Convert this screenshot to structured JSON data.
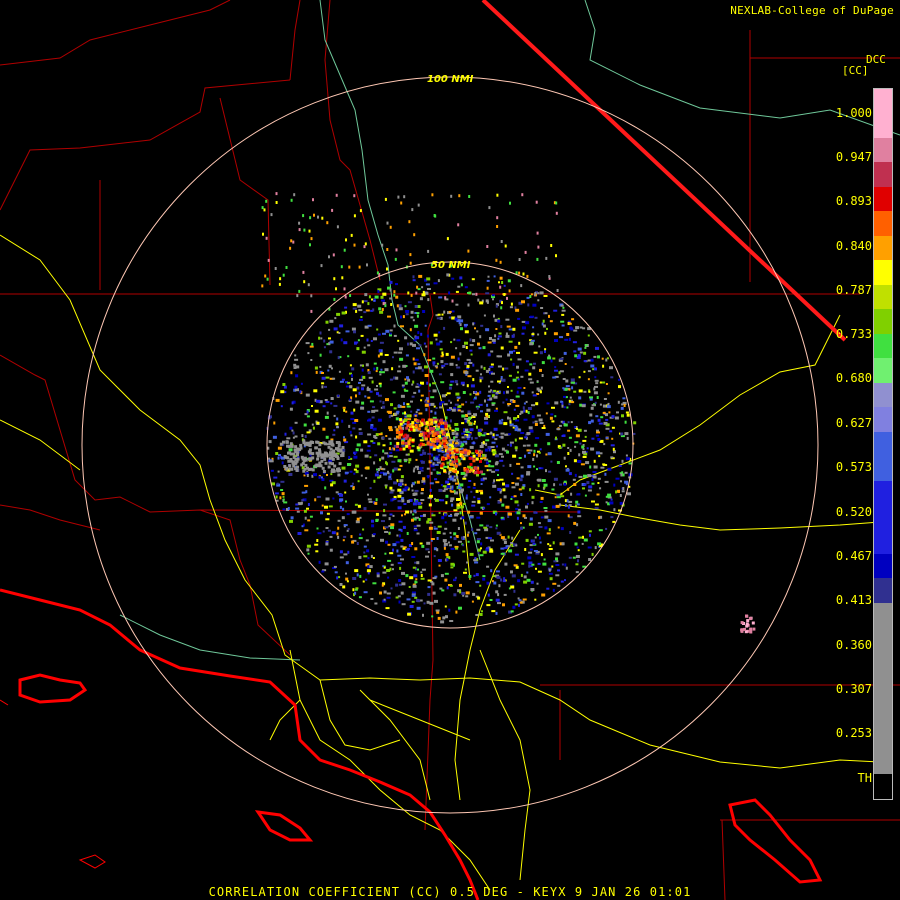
{
  "credit": "NEXLAB-College of DuPage",
  "station_code": "DCC",
  "unit_label": "[CC]",
  "legend_labels": [
    "1.000",
    "0.947",
    "0.893",
    "0.840",
    "0.787",
    "0.733",
    "0.680",
    "0.627",
    "0.573",
    "0.520",
    "0.467",
    "0.413",
    "0.360",
    "0.307",
    "0.253",
    "TH"
  ],
  "legend_colors": [
    "#ffb0d0",
    "#e080a0",
    "#c03050",
    "#e00000",
    "#ff6000",
    "#ffa000",
    "#ffff00",
    "#c0e000",
    "#80d000",
    "#40e040",
    "#70f070",
    "#9090d0",
    "#8080e0",
    "#4060e0",
    "#2020e0",
    "#0000c0",
    "#303090",
    "#909090",
    "#000000"
  ],
  "range_rings": [
    "50 NMI",
    "100 NMI"
  ],
  "footer": "CORRELATION COEFFICIENT (CC) 0.5 DEG - KEYX 9 JAN 26 01:01",
  "colors": {
    "text": "#ffff00",
    "borders": "#ff0000",
    "coast": "#ff0000",
    "roads": "#ffff00",
    "rings": "#ffc8b4",
    "rivers": "#7fd0a0"
  }
}
